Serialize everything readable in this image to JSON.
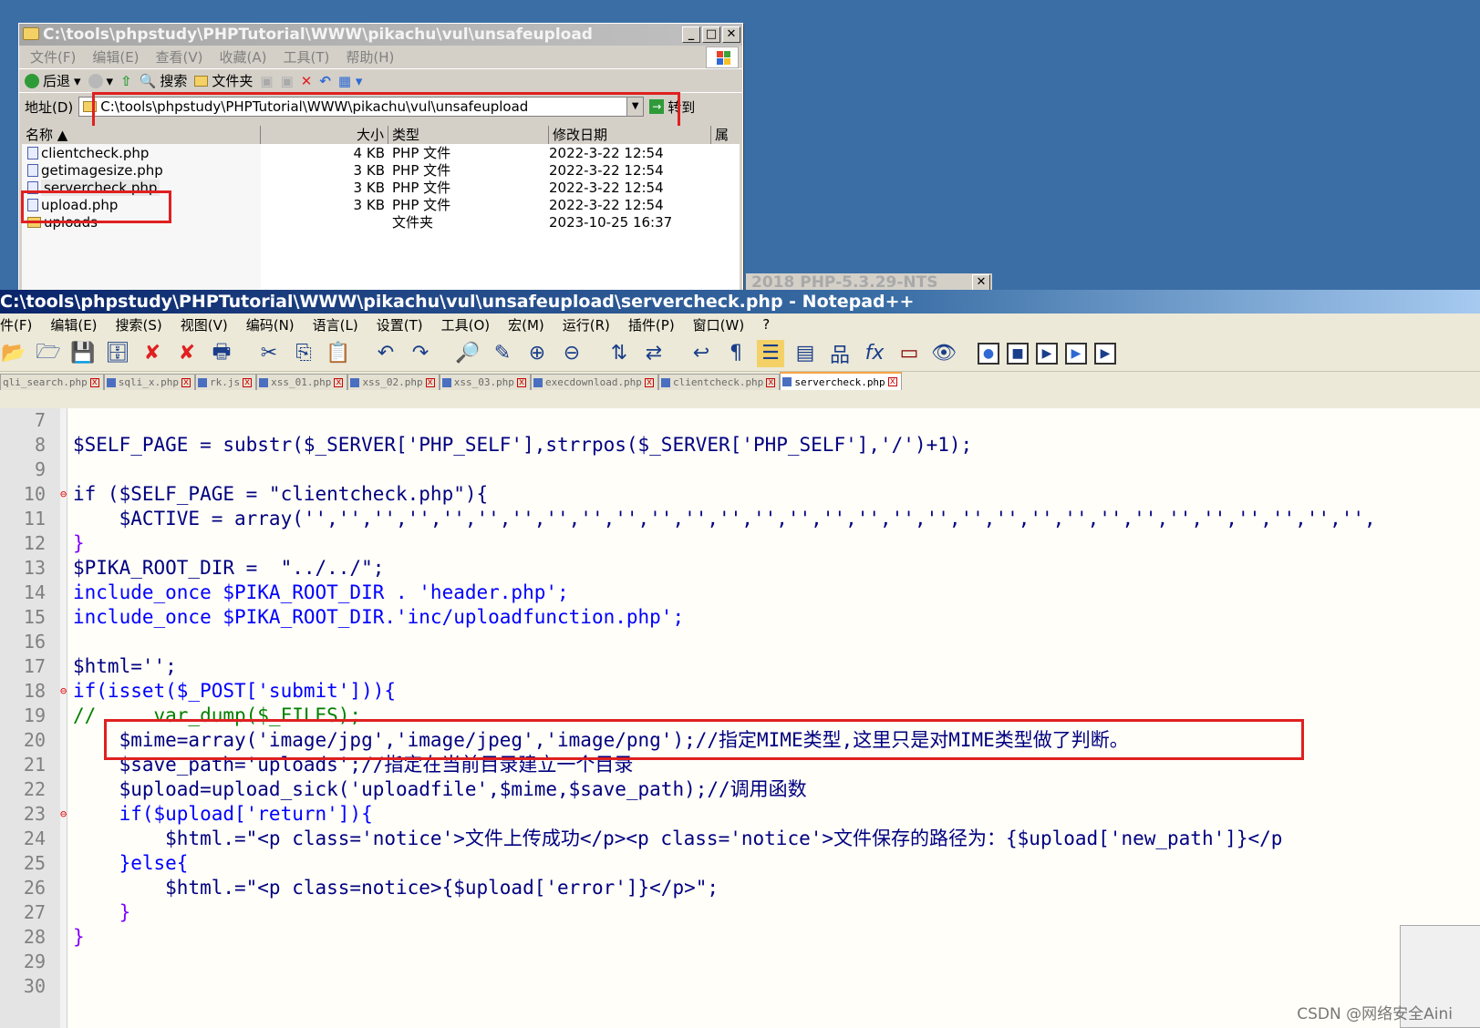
{
  "explorer": {
    "title": "C:\\tools\\phpstudy\\PHPTutorial\\WWW\\pikachu\\vul\\unsafeupload",
    "menu": [
      "文件(F)",
      "编辑(E)",
      "查看(V)",
      "收藏(A)",
      "工具(T)",
      "帮助(H)"
    ],
    "toolbar": {
      "back": "后退",
      "search": "搜索",
      "folders": "文件夹"
    },
    "address_label": "地址(D)",
    "address_value": "C:\\tools\\phpstudy\\PHPTutorial\\WWW\\pikachu\\vul\\unsafeupload",
    "go_label": "转到",
    "columns": [
      "名称",
      "大小",
      "类型",
      "修改日期",
      "属"
    ],
    "files": [
      {
        "name": "clientcheck.php",
        "size": "4 KB",
        "type": "PHP 文件",
        "date": "2022-3-22 12:54"
      },
      {
        "name": "getimagesize.php",
        "size": "3 KB",
        "type": "PHP 文件",
        "date": "2022-3-22 12:54"
      },
      {
        "name": "servercheck.php",
        "size": "3 KB",
        "type": "PHP 文件",
        "date": "2022-3-22 12:54"
      },
      {
        "name": "upload.php",
        "size": "3 KB",
        "type": "PHP 文件",
        "date": "2022-3-22 12:54"
      },
      {
        "name": "uploads",
        "size": "",
        "type": "文件夹",
        "date": "2023-10-25 16:37"
      }
    ]
  },
  "tray_title": "2018    PHP-5.3.29-NTS",
  "notepad": {
    "title": "C:\\tools\\phpstudy\\PHPTutorial\\WWW\\pikachu\\vul\\unsafeupload\\servercheck.php - Notepad++",
    "menu": [
      "件(F)",
      "编辑(E)",
      "搜索(S)",
      "视图(V)",
      "编码(N)",
      "语言(L)",
      "设置(T)",
      "工具(O)",
      "宏(M)",
      "运行(R)",
      "插件(P)",
      "窗口(W)",
      "?"
    ],
    "tabs": [
      "qli_search.php",
      "sqli_x.php",
      "rk.js",
      "xss_01.php",
      "xss_02.php",
      "xss_03.php",
      "execdownload.php",
      "clientcheck.php",
      "servercheck.php"
    ],
    "active_tab": "servercheck.php"
  },
  "code_lines": [
    {
      "n": "7"
    },
    {
      "n": "8"
    },
    {
      "n": "9"
    },
    {
      "n": "10"
    },
    {
      "n": "11"
    },
    {
      "n": "12"
    },
    {
      "n": "13"
    },
    {
      "n": "14"
    },
    {
      "n": "15"
    },
    {
      "n": "16"
    },
    {
      "n": "17"
    },
    {
      "n": "18"
    },
    {
      "n": "19"
    },
    {
      "n": "20"
    },
    {
      "n": "21"
    },
    {
      "n": "22"
    },
    {
      "n": "23"
    },
    {
      "n": "24"
    },
    {
      "n": "25"
    },
    {
      "n": "26"
    },
    {
      "n": "27"
    },
    {
      "n": "28"
    },
    {
      "n": "29"
    },
    {
      "n": "30"
    }
  ],
  "code_text": {
    "l8": "$SELF_PAGE = substr($_SERVER['PHP_SELF'],strrpos($_SERVER['PHP_SELF'],'/')+1);",
    "l10": "if ($SELF_PAGE = \"clientcheck.php\"){",
    "l11": "    $ACTIVE = array('','','','','','','','','','','','','','','','','','','','','','','','','','','','','','','',",
    "l12": "}",
    "l13": "$PIKA_ROOT_DIR =  \"../../\";",
    "l14": "include_once $PIKA_ROOT_DIR . 'header.php';",
    "l15": "include_once $PIKA_ROOT_DIR.'inc/uploadfunction.php';",
    "l17": "$html='';",
    "l18": "if(isset($_POST['submit'])){",
    "l19": "//     var_dump($_FILES);",
    "l20": "    $mime=array('image/jpg','image/jpeg','image/png');//指定MIME类型,这里只是对MIME类型做了判断。",
    "l21": "    $save_path='uploads';//指定在当前目录建立一个目录",
    "l22": "    $upload=upload_sick('uploadfile',$mime,$save_path);//调用函数",
    "l23": "    if($upload['return']){",
    "l24": "        $html.=\"<p class='notice'>文件上传成功</p><p class='notice'>文件保存的路径为：{$upload['new_path']}</p",
    "l25": "    }else{",
    "l26": "        $html.=\"<p class=notice>{$upload['error']}</p>\";",
    "l27": "    }",
    "l28": "}"
  },
  "watermark": "CSDN @网络安全Aini",
  "colors": {
    "highlight_box": "#e02020",
    "keyword": "#0000ff",
    "comment": "#008000",
    "string": "#808080"
  }
}
